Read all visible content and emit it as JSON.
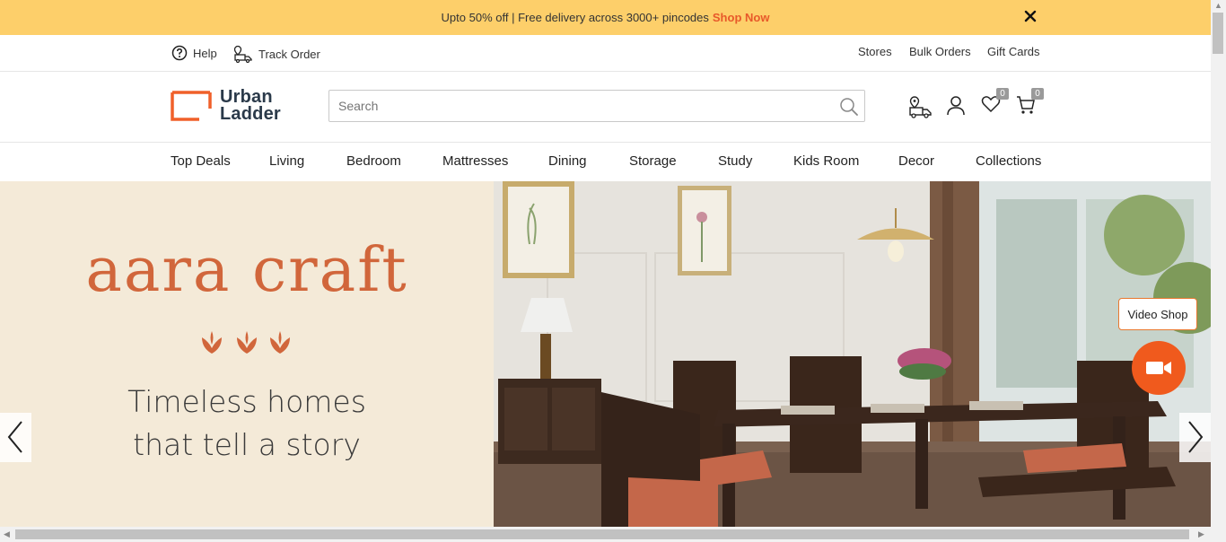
{
  "promo": {
    "text": "Upto 50% off | Free delivery across 3000+ pincodes",
    "cta": "Shop Now"
  },
  "util": {
    "help": "Help",
    "track_order": "Track Order",
    "stores": "Stores",
    "bulk_orders": "Bulk Orders",
    "gift_cards": "Gift Cards"
  },
  "logo": {
    "line1": "Urban",
    "line2": "Ladder"
  },
  "search": {
    "placeholder": "Search"
  },
  "header": {
    "wishlist_count": "0",
    "cart_count": "0"
  },
  "nav": [
    "Top Deals",
    "Living",
    "Bedroom",
    "Mattresses",
    "Dining",
    "Storage",
    "Study",
    "Kids Room",
    "Decor",
    "Collections"
  ],
  "hero": {
    "brand": "aara craft",
    "tagline_line1": "Timeless homes",
    "tagline_line2": "that tell a story"
  },
  "video_shop": {
    "label": "Video Shop"
  },
  "colors": {
    "promo_bg": "#fdcf6a",
    "accent": "#e8592a",
    "brand_title": "#d1663b"
  }
}
